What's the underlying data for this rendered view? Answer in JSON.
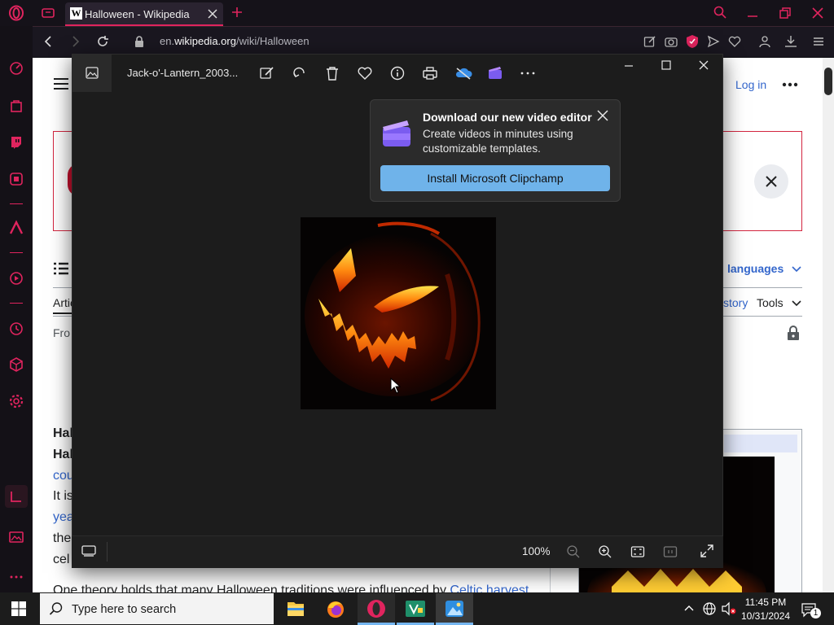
{
  "browser": {
    "tab_title": "Halloween - Wikipedia",
    "tab_favicon": "W",
    "url_prefix": "en.",
    "url_domain": "wikipedia.org",
    "url_path": "/wiki/Halloween",
    "accent": "#e0245e"
  },
  "wiki": {
    "login": "Log in",
    "languages": "languages",
    "history": "story",
    "tools": "Tools",
    "tab_article": "Artic",
    "from_text": "Fro",
    "body_lines": [
      "Hal",
      "Hal",
      "cou",
      "It is",
      "yea",
      "the",
      "cel"
    ],
    "bottom_line_plain": "One theory holds that many Halloween traditions were influenced by ",
    "bottom_line_link": "Celtic harvest"
  },
  "viewer": {
    "file_name": "Jack-o'-Lantern_2003...",
    "zoom": "100%",
    "popup": {
      "title": "Download our new video editor",
      "body": "Create videos in minutes using customizable templates.",
      "button": "Install Microsoft Clipchamp"
    }
  },
  "taskbar": {
    "search_placeholder": "Type here to search",
    "time": "11:45 PM",
    "date": "10/31/2024",
    "notification_count": "1"
  }
}
